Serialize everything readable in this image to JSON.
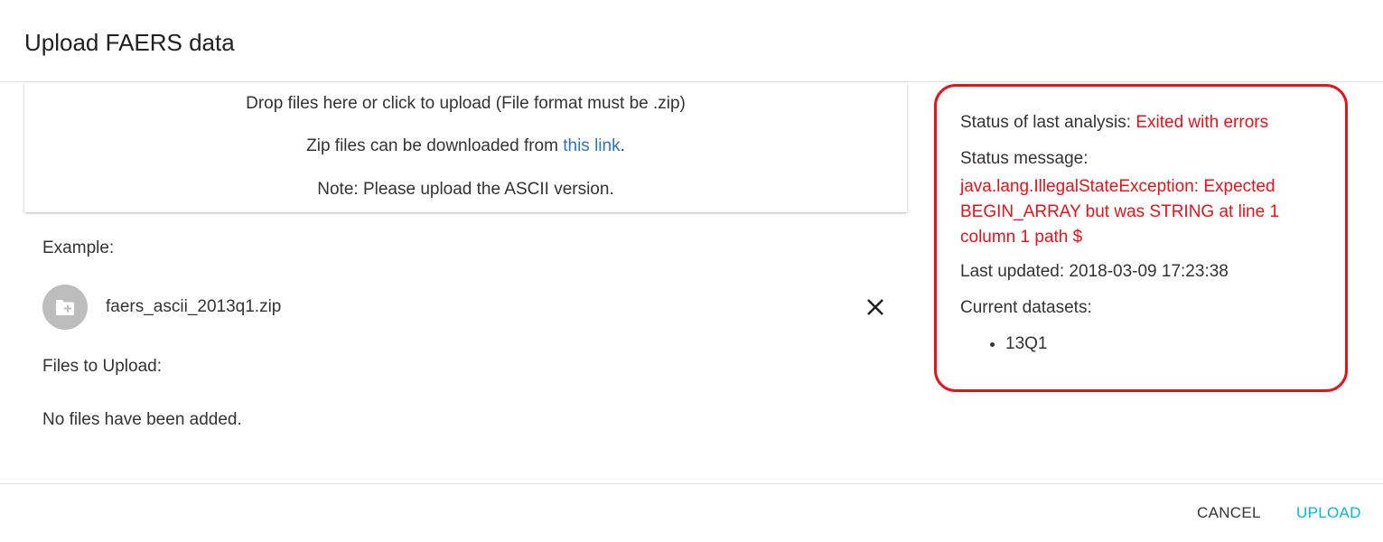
{
  "dialog": {
    "title": "Upload FAERS data"
  },
  "dropzone": {
    "instruction": "Drop files here or click to upload (File format must be .zip)",
    "download_prefix": "Zip files can be downloaded from ",
    "download_link_text": "this link",
    "download_suffix": ".",
    "note": "Note: Please upload the ASCII version."
  },
  "example": {
    "label": "Example:",
    "file_name": "faers_ascii_2013q1.zip",
    "avatar_icon": "folder-add-icon",
    "remove_icon": "close-icon"
  },
  "files_to_upload": {
    "label": "Files to Upload:",
    "empty_message": "No files have been added."
  },
  "status": {
    "last_analysis_label": "Status of last analysis: ",
    "last_analysis_value": "Exited with errors",
    "message_label": "Status message:",
    "message_value": "java.lang.IllegalStateException: Expected BEGIN_ARRAY but was STRING at line 1 column 1 path $",
    "last_updated": "Last updated: 2018-03-09 17:23:38",
    "datasets_label": "Current datasets:",
    "datasets": [
      "13Q1"
    ],
    "error_color": "#e4141a"
  },
  "footer": {
    "cancel_label": "CANCEL",
    "upload_label": "UPLOAD",
    "accent_color": "#00bcd4"
  }
}
